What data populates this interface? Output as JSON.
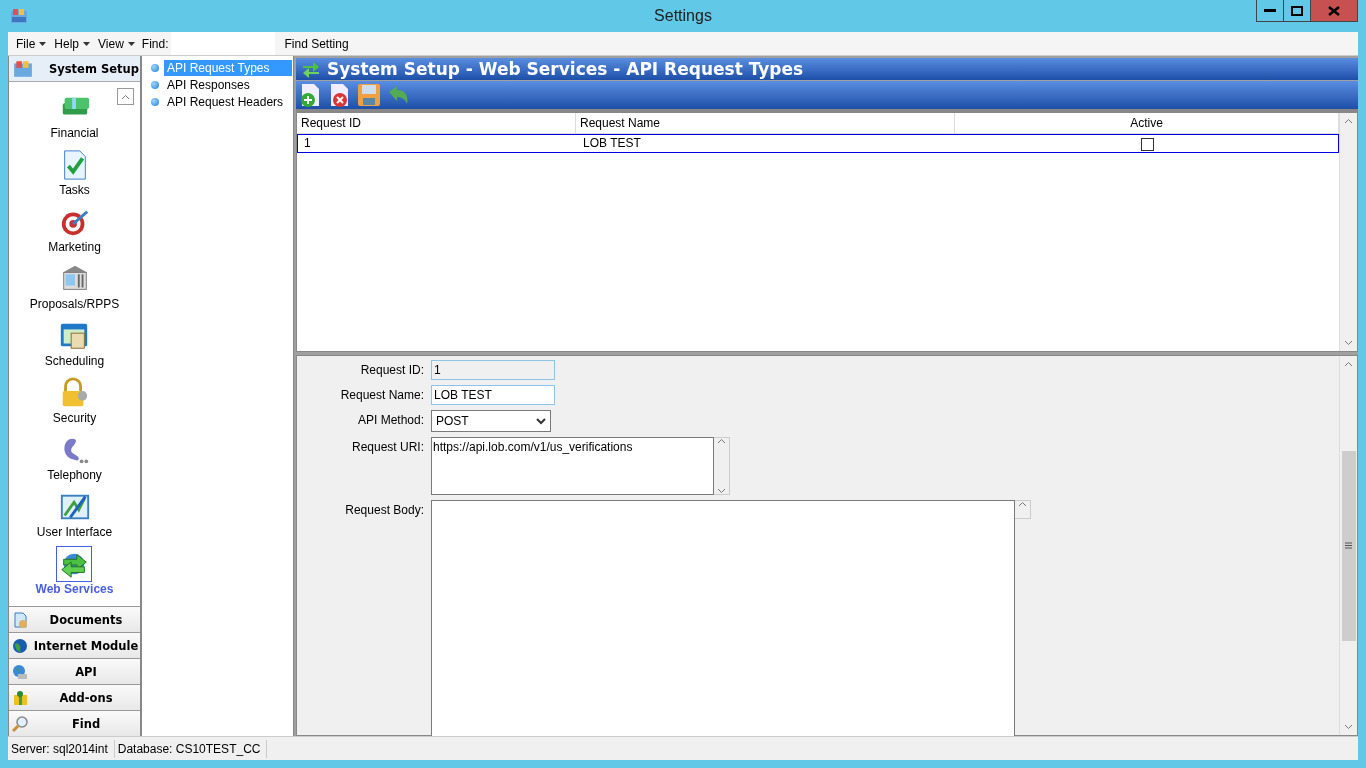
{
  "window": {
    "title": "Settings"
  },
  "menu": [
    {
      "label": "File"
    },
    {
      "label": "Help"
    },
    {
      "label": "View"
    }
  ],
  "find": {
    "label": "Find:",
    "button": "Find Setting"
  },
  "nav": {
    "header": "System Setup",
    "items": [
      {
        "label": "Financial",
        "selected": false
      },
      {
        "label": "Tasks",
        "selected": false
      },
      {
        "label": "Marketing",
        "selected": false
      },
      {
        "label": "Proposals/RPPS",
        "selected": false
      },
      {
        "label": "Scheduling",
        "selected": false
      },
      {
        "label": "Security",
        "selected": false
      },
      {
        "label": "Telephony",
        "selected": false
      },
      {
        "label": "User Interface",
        "selected": false
      },
      {
        "label": "Web Services",
        "selected": true
      }
    ],
    "sections": [
      "Documents",
      "Internet Module",
      "API",
      "Add-ons",
      "Find"
    ]
  },
  "tree": [
    {
      "label": "API Request Types",
      "selected": true
    },
    {
      "label": "API Responses",
      "selected": false
    },
    {
      "label": "API Request Headers",
      "selected": false
    }
  ],
  "panel": {
    "title": "System Setup - Web Services - API Request Types",
    "table": {
      "columns": [
        "Request ID",
        "Request Name",
        "Active"
      ],
      "rows": [
        {
          "cells": [
            "1",
            "LOB TEST"
          ],
          "active": false,
          "selected": true
        }
      ]
    },
    "form": [
      {
        "kind": "readonly",
        "label": "Request ID:",
        "value": "1"
      },
      {
        "kind": "text",
        "label": "Request Name:",
        "value": "LOB TEST"
      },
      {
        "kind": "select",
        "label": "API Method:",
        "value": "POST"
      },
      {
        "kind": "textarea",
        "label": "Request URI:",
        "value": "https://api.lob.com/v1/us_verifications"
      },
      {
        "kind": "bigtext",
        "label": "Request Body:"
      }
    ]
  },
  "status_bar": [
    "Server: sql2014int",
    "Database: CS10TEST_CC"
  ]
}
